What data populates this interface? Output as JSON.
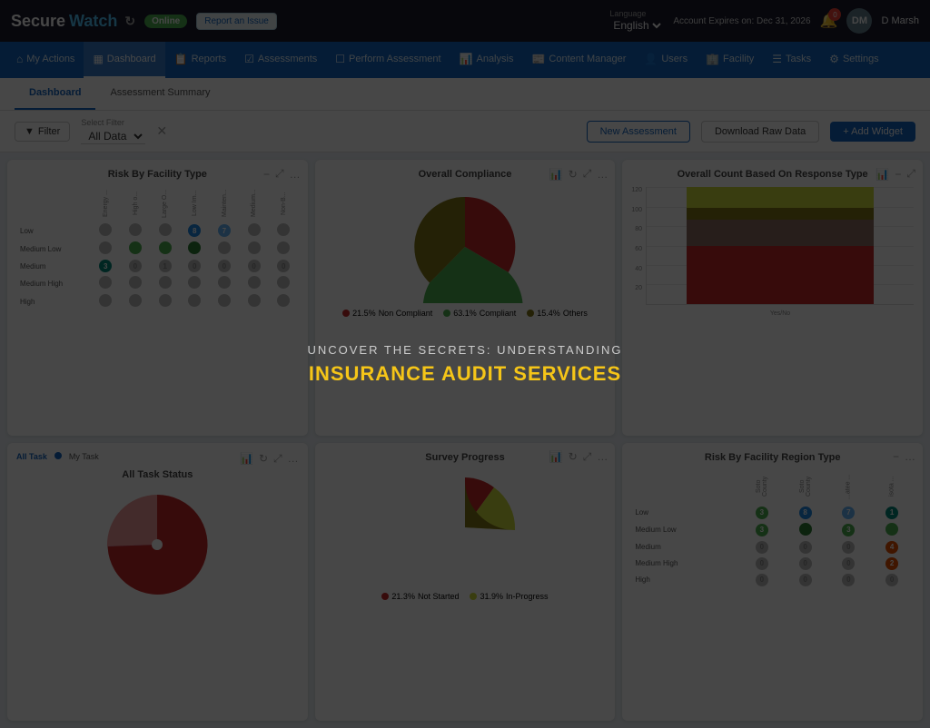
{
  "topbar": {
    "logo_secure": "Secure",
    "logo_watch": "Watch",
    "online_label": "Online",
    "report_issue": "Report an Issue",
    "language_label": "Language",
    "language_value": "English",
    "account_expires": "Account Expires on: Dec 31, 2026",
    "notif_count": "0",
    "user_initials": "DM",
    "user_name": "D Marsh"
  },
  "nav": {
    "items": [
      {
        "label": "My Actions",
        "icon": "⌂",
        "active": false
      },
      {
        "label": "Dashboard",
        "icon": "▦",
        "active": true
      },
      {
        "label": "Reports",
        "icon": "📋",
        "active": false
      },
      {
        "label": "Assessments",
        "icon": "☑",
        "active": false
      },
      {
        "label": "Perform Assessment",
        "icon": "☐",
        "active": false
      },
      {
        "label": "Analysis",
        "icon": "📊",
        "active": false
      },
      {
        "label": "Content Manager",
        "icon": "📰",
        "active": false
      },
      {
        "label": "Users",
        "icon": "👤",
        "active": false
      },
      {
        "label": "Facility",
        "icon": "🏢",
        "active": false
      },
      {
        "label": "Tasks",
        "icon": "☰",
        "active": false
      },
      {
        "label": "Settings",
        "icon": "⚙",
        "active": false
      }
    ]
  },
  "subtabs": {
    "tabs": [
      {
        "label": "Dashboard",
        "active": true
      },
      {
        "label": "Assessment Summary",
        "active": false
      }
    ]
  },
  "filterbar": {
    "filter_btn": "Filter",
    "select_filter_label": "Select Filter",
    "filter_value": "All Data",
    "new_assessment": "New Assessment",
    "download_raw_data": "Download Raw Data",
    "add_widget": "+ Add Widget"
  },
  "widgets": {
    "risk_facility": {
      "title": "Risk By Facility Type",
      "rows": [
        {
          "label": "Low",
          "values": [
            {
              "val": "",
              "color": "gray"
            },
            {
              "val": "",
              "color": "gray"
            },
            {
              "val": "",
              "color": "gray"
            },
            {
              "val": "8",
              "color": "blue"
            },
            {
              "val": "7",
              "color": "lightblue"
            },
            {
              "val": "",
              "color": "gray"
            },
            {
              "val": "",
              "color": "gray"
            }
          ]
        },
        {
          "label": "Medium Low",
          "values": [
            {
              "val": "",
              "color": "gray"
            },
            {
              "val": "",
              "color": "green"
            },
            {
              "val": "",
              "color": "green"
            },
            {
              "val": "",
              "color": "darkgreen"
            },
            {
              "val": "",
              "color": "gray"
            },
            {
              "val": "",
              "color": "gray"
            },
            {
              "val": "",
              "color": "gray"
            }
          ]
        },
        {
          "label": "Medium",
          "values": [
            {
              "val": "3",
              "color": "teal"
            },
            {
              "val": "0",
              "color": "gray"
            },
            {
              "val": "1",
              "color": "gray"
            },
            {
              "val": "0",
              "color": "gray"
            },
            {
              "val": "0",
              "color": "gray"
            },
            {
              "val": "0",
              "color": "gray"
            },
            {
              "val": "0",
              "color": "gray"
            }
          ]
        },
        {
          "label": "Medium High",
          "values": [
            {
              "val": "",
              "color": "gray"
            },
            {
              "val": "",
              "color": "gray"
            },
            {
              "val": "",
              "color": "gray"
            },
            {
              "val": "",
              "color": "gray"
            },
            {
              "val": "",
              "color": "gray"
            },
            {
              "val": "",
              "color": "gray"
            },
            {
              "val": "",
              "color": "gray"
            }
          ]
        },
        {
          "label": "High",
          "values": [
            {
              "val": "",
              "color": "gray"
            },
            {
              "val": "",
              "color": "gray"
            },
            {
              "val": "",
              "color": "gray"
            },
            {
              "val": "",
              "color": "gray"
            },
            {
              "val": "",
              "color": "gray"
            },
            {
              "val": "",
              "color": "gray"
            },
            {
              "val": "",
              "color": "gray"
            }
          ]
        }
      ],
      "col_labels": [
        "Energy ...",
        "High o...",
        "Large O...",
        "Low Im...",
        "Mainten...",
        "Medium...",
        "Non-B..."
      ]
    },
    "overall_compliance": {
      "title": "Overall Compliance",
      "non_compliant_pct": "21.5%",
      "non_compliant_label": "Non Compliant",
      "compliant_pct": "63.1%",
      "compliant_label": "Compliant",
      "others_pct": "15.4%",
      "others_label": "Others"
    },
    "overall_count": {
      "title": "Overall Count Based On Response Type",
      "y_labels": [
        "120",
        "100",
        "80",
        "60",
        "40",
        "20",
        ""
      ],
      "x_labels": [
        "Yes/No"
      ],
      "bars": [
        {
          "color": "#cddc39",
          "left": "0%",
          "width": "85%",
          "height_pct": 85
        },
        {
          "color": "#8d6e63",
          "left": "0%",
          "width": "70%",
          "height_pct": 70
        },
        {
          "color": "#e65100",
          "left": "0%",
          "width": "55%",
          "height_pct": 55
        }
      ]
    },
    "all_task_status": {
      "title": "All Task Status",
      "toggle_all": "All Task",
      "toggle_my": "My Task"
    },
    "survey_progress": {
      "title": "Survey Progress",
      "not_started_pct": "21.3%",
      "not_started_label": "Not Started",
      "in_progress_pct": "31.9%",
      "in_progress_label": "In-Progress"
    },
    "risk_region": {
      "title": "Risk By Facility Region Type",
      "rows": [
        {
          "label": "Low",
          "values": [
            {
              "val": "3",
              "color": "green"
            },
            {
              "val": "8",
              "color": "blue"
            },
            {
              "val": "7",
              "color": "lightblue"
            },
            {
              "val": "1",
              "color": "teal"
            }
          ]
        },
        {
          "label": "Medium Low",
          "values": [
            {
              "val": "3",
              "color": "green"
            },
            {
              "val": "",
              "color": "darkgreen"
            },
            {
              "val": "3",
              "color": "green"
            },
            {
              "val": "",
              "color": "green"
            }
          ]
        },
        {
          "label": "Medium",
          "values": [
            {
              "val": "0",
              "color": "gray"
            },
            {
              "val": "0",
              "color": "gray"
            },
            {
              "val": "0",
              "color": "gray"
            },
            {
              "val": "4",
              "color": "orange"
            }
          ]
        },
        {
          "label": "Medium High",
          "values": [
            {
              "val": "0",
              "color": "gray"
            },
            {
              "val": "0",
              "color": "gray"
            },
            {
              "val": "0",
              "color": "gray"
            },
            {
              "val": "2",
              "color": "orange"
            }
          ]
        },
        {
          "label": "High",
          "values": [
            {
              "val": "0",
              "color": "gray"
            },
            {
              "val": "0",
              "color": "gray"
            },
            {
              "val": "0",
              "color": "gray"
            },
            {
              "val": "0",
              "color": "gray"
            }
          ]
        }
      ],
      "col_labels": [
        "Soto County",
        "Soto County",
        "...atee ...",
        "isota ..."
      ]
    }
  },
  "overlay": {
    "subtitle": "Uncover the Secrets: Understanding",
    "title": "Insurance Audit Services"
  },
  "colors": {
    "primary": "#1565c0",
    "nav_bg": "#1565c0",
    "topbar_bg": "#1a1a2e",
    "accent_yellow": "#f5c518",
    "pie_red": "#c62828",
    "pie_orange": "#e65100",
    "pie_olive": "#827717",
    "pie_green": "#4caf50",
    "pie_yellow_green": "#cddc39"
  }
}
